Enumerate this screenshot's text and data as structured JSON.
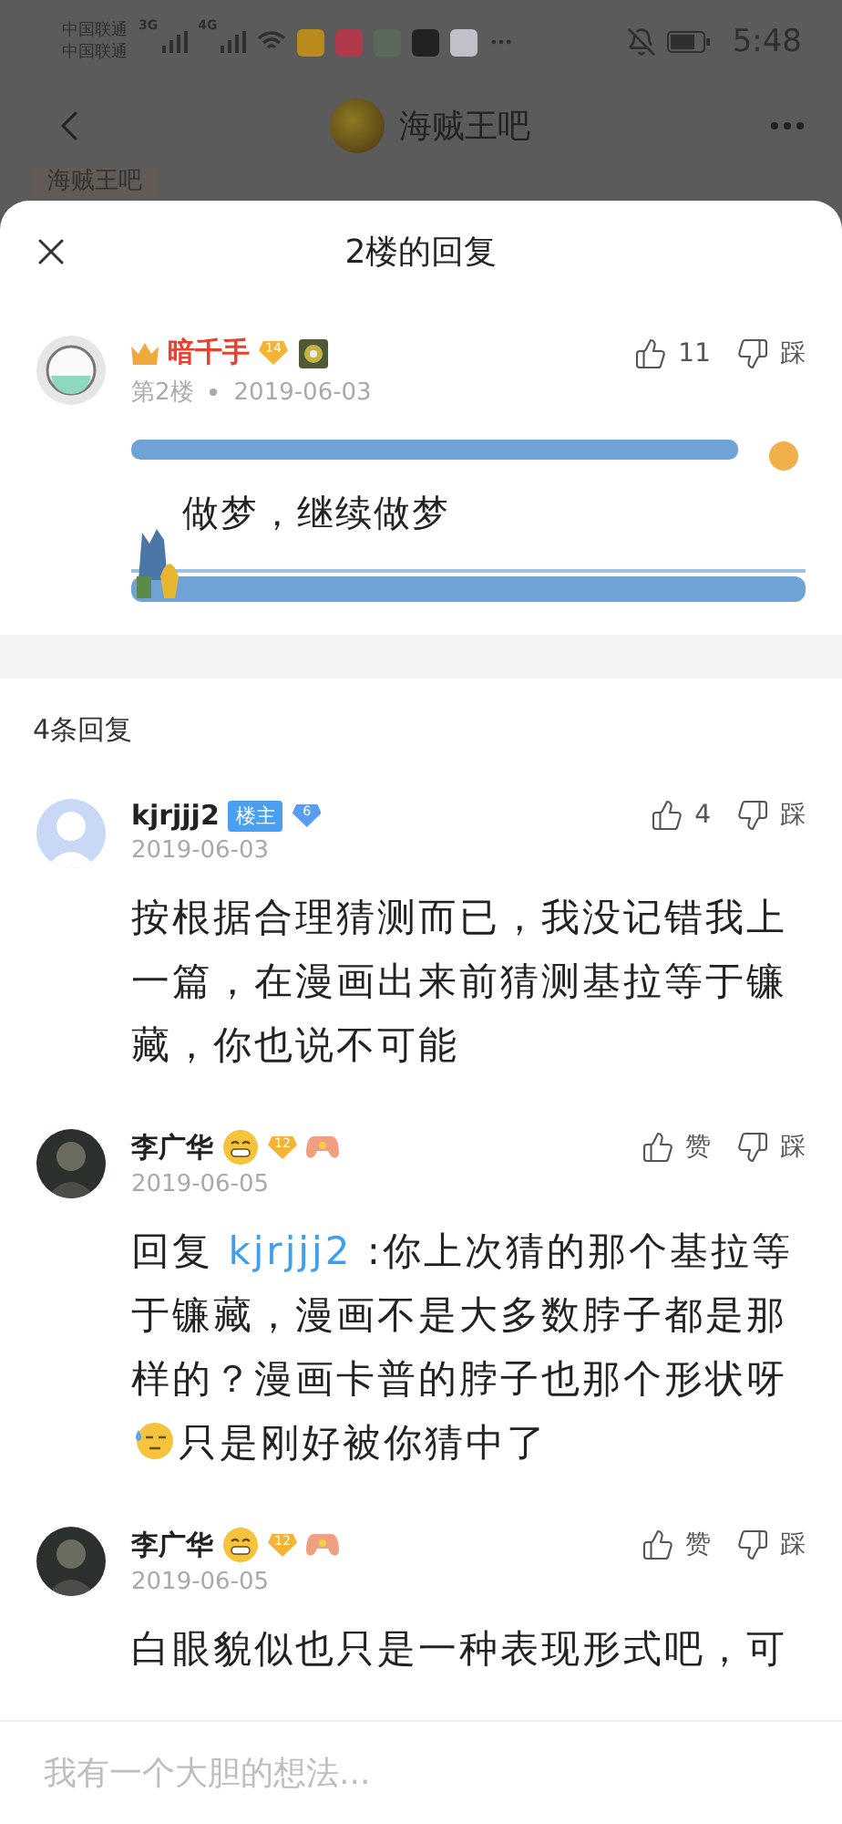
{
  "status_bar": {
    "carriers": [
      "中国联通",
      "中国联通"
    ],
    "networks": [
      "3G",
      "4G"
    ],
    "time": "5:48"
  },
  "header": {
    "title": "海贼王吧",
    "tag": "海贼王吧"
  },
  "sheet": {
    "title": "2楼的回复"
  },
  "post": {
    "kind": "author",
    "user": "暗千手",
    "level": {
      "text": "14",
      "color": "#f5b335"
    },
    "floor": "第2楼",
    "date": "2019-06-03",
    "likes": "11",
    "dislike": "踩",
    "text": "做梦，继续做梦"
  },
  "reply_count": "4条回复",
  "replies": [
    {
      "kind": "op",
      "user": "kjrjjj2",
      "badge": "楼主",
      "level": {
        "text": "6",
        "color": "#5b9cf0"
      },
      "date": "2019-06-03",
      "likes": "4",
      "dislike": "踩",
      "segments": [
        {
          "kind": "text",
          "text": "按根据合理猜测而已，我没记错我上一篇，在漫画出来前猜测基拉等于镰藏，你也说不可能"
        }
      ]
    },
    {
      "kind": "member",
      "user": "李广华",
      "level": {
        "text": "12",
        "color": "#f5b335"
      },
      "date": "2019-06-05",
      "likes": "赞",
      "dislike": "踩",
      "segments": [
        {
          "kind": "text",
          "text": "回复 "
        },
        {
          "kind": "mention",
          "text": "kjrjjj2"
        },
        {
          "kind": "text",
          "text": " :你上次猜的那个基拉等于镰藏，漫画不是大多数脖子都是那样的？漫画卡普的脖子也那个形状呀"
        },
        {
          "kind": "emoji"
        },
        {
          "kind": "text",
          "text": "只是刚好被你猜中了"
        }
      ]
    },
    {
      "kind": "member",
      "user": "李广华",
      "level": {
        "text": "12",
        "color": "#f5b335"
      },
      "date": "2019-06-05",
      "likes": "赞",
      "dislike": "踩",
      "segments": [
        {
          "kind": "text",
          "text": "白眼貌似也只是一种表现形式吧，可"
        }
      ]
    }
  ],
  "input": {
    "placeholder": "我有一个大胆的想法..."
  }
}
